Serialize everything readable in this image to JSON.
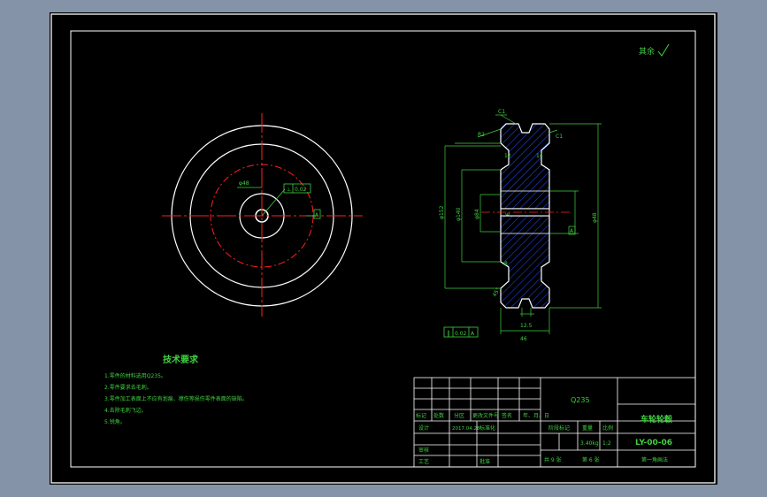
{
  "drawing": {
    "corner_note": "其余",
    "tech_title": "技术要求",
    "tech_notes": [
      "1.零件的材料选用Q235。",
      "2.零件要求去毛刺。",
      "3.零件加工表面上不应有划痕、擦伤等损伤零件表面的缺陷。",
      "4.去除毛刺飞边。",
      "5.锐角。"
    ],
    "front_view_labels": {
      "hole_dim": "φ48",
      "runout_tol": "0.02",
      "datum": "A"
    },
    "section_view_labels": {
      "chamfer_top": "C1",
      "chamfer_right": "C1",
      "r2": "R2",
      "width_top": "12",
      "width_mid": "14",
      "width_bottom": "8",
      "d_outer": "φ152",
      "d_mid": "φ140",
      "d_hub": "φ84",
      "d_bore": "φ48",
      "slot": "6",
      "bottom_dim": "12.5",
      "overall_width": "46",
      "angle": "45°",
      "datum_a": "A",
      "flatness_sym": "∥",
      "flatness_val": "0.02",
      "flatness_datum": "A"
    }
  },
  "title_block": {
    "material": "Q235",
    "part_name": "车轮轮毂",
    "drawing_no": "LY-00-06",
    "mark_header": "标记",
    "count_header": "处数",
    "zone_header": "分区",
    "doc_no_header": "更改文件号",
    "sign_header": "签名",
    "date_header": "年、月、日",
    "design_label": "设计",
    "design_date": "2017.04.28",
    "std_label": "标准化",
    "stage_label": "阶段标记",
    "weight_label": "重量",
    "scale_label": "比例",
    "weight_value": "3.40kg",
    "scale_value": "1:2",
    "review_label": "审核",
    "craft_label": "工艺",
    "approve_label": "批准",
    "sheets_total": "共 9 张",
    "sheet_no": "第 6 张",
    "projection": "第一角画法"
  }
}
